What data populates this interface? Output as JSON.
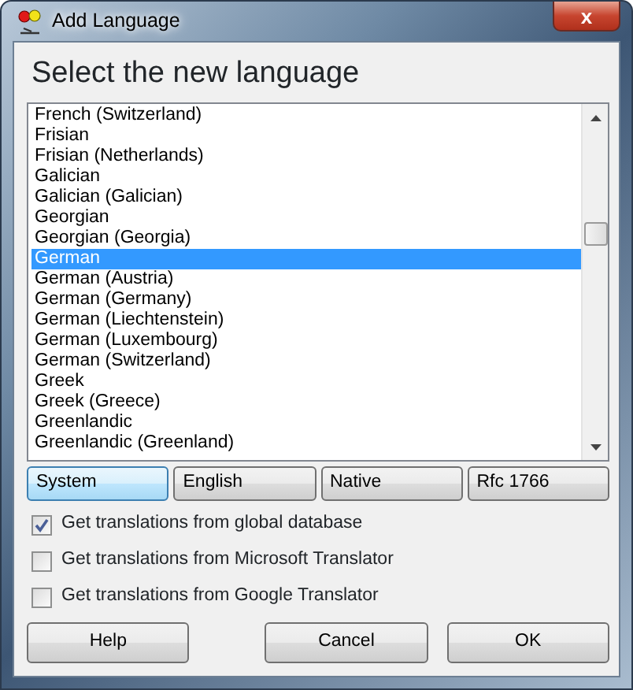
{
  "window": {
    "title": "Add Language",
    "close": "x"
  },
  "heading": "Select the new language",
  "languages": [
    {
      "label": "French (Switzerland)",
      "selected": false
    },
    {
      "label": "Frisian",
      "selected": false
    },
    {
      "label": "Frisian (Netherlands)",
      "selected": false
    },
    {
      "label": "Galician",
      "selected": false
    },
    {
      "label": "Galician (Galician)",
      "selected": false
    },
    {
      "label": "Georgian",
      "selected": false
    },
    {
      "label": "Georgian (Georgia)",
      "selected": false
    },
    {
      "label": "German",
      "selected": true
    },
    {
      "label": "German (Austria)",
      "selected": false
    },
    {
      "label": "German (Germany)",
      "selected": false
    },
    {
      "label": "German (Liechtenstein)",
      "selected": false
    },
    {
      "label": "German (Luxembourg)",
      "selected": false
    },
    {
      "label": "German (Switzerland)",
      "selected": false
    },
    {
      "label": "Greek",
      "selected": false
    },
    {
      "label": "Greek (Greece)",
      "selected": false
    },
    {
      "label": "Greenlandic",
      "selected": false
    },
    {
      "label": "Greenlandic (Greenland)",
      "selected": false
    }
  ],
  "name_modes": [
    {
      "label": "System",
      "selected": true
    },
    {
      "label": "English",
      "selected": false
    },
    {
      "label": "Native",
      "selected": false
    },
    {
      "label": "Rfc 1766",
      "selected": false
    }
  ],
  "options": [
    {
      "label": "Get translations from global database",
      "checked": true
    },
    {
      "label": "Get translations from Microsoft Translator",
      "checked": false
    },
    {
      "label": "Get translations from Google Translator",
      "checked": false
    }
  ],
  "buttons": [
    "Help",
    "Cancel",
    "OK"
  ]
}
